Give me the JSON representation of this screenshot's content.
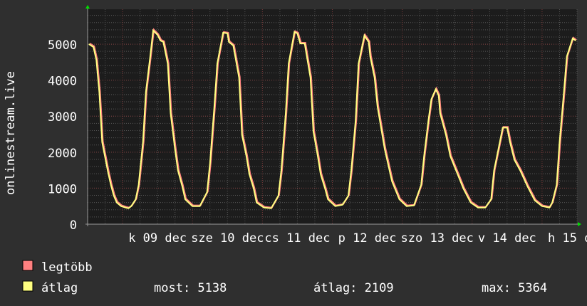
{
  "chart_data": {
    "type": "line",
    "ylabel": "onlinestream.live",
    "ylim": [
      0,
      5970
    ],
    "yticks": [
      0,
      1000,
      2000,
      3000,
      4000,
      5000
    ],
    "xrange": [
      "12-08 12:00",
      "12-15 12:00"
    ],
    "xticks": [
      {
        "t": "12-09 12:00",
        "label": "k 09 dec"
      },
      {
        "t": "12-10 12:00",
        "label": "sze 10 dec"
      },
      {
        "t": "12-11 12:00",
        "label": "cs 11 dec"
      },
      {
        "t": "12-12 12:00",
        "label": "p 12 dec"
      },
      {
        "t": "12-13 12:00",
        "label": "szo 13 dec"
      },
      {
        "t": "12-14 12:00",
        "label": "v 14 dec"
      },
      {
        "t": "12-15 12:00",
        "label": "h 15 dec"
      }
    ],
    "grid": true,
    "colors": {
      "background": "#2f2f2f",
      "canvas": "#1c1c1c",
      "grid_minor": "#555555",
      "grid_major": "#7a3a3a",
      "axis_arrow": "#00dd00"
    },
    "series": [
      {
        "name": "legtöbb",
        "color": "#ff8080"
      },
      {
        "name": "átlag",
        "color": "#ffff80"
      }
    ],
    "points": [
      [
        "12-08 12:30",
        5000
      ],
      [
        "12-08 14:00",
        4920
      ],
      [
        "12-08 15:00",
        4560
      ],
      [
        "12-08 16:00",
        3670
      ],
      [
        "12-08 17:00",
        2280
      ],
      [
        "12-08 19:00",
        1450
      ],
      [
        "12-08 20:00",
        1090
      ],
      [
        "12-08 21:00",
        790
      ],
      [
        "12-08 22:00",
        600
      ],
      [
        "12-08 23:30",
        500
      ],
      [
        "12-09 01:00",
        460
      ],
      [
        "12-09 02:00",
        440
      ],
      [
        "12-09 03:00",
        500
      ],
      [
        "12-09 04:30",
        690
      ],
      [
        "12-09 05:30",
        1090
      ],
      [
        "12-09 07:00",
        2280
      ],
      [
        "12-09 08:00",
        3670
      ],
      [
        "12-09 09:30",
        4660
      ],
      [
        "12-09 10:30",
        5380
      ],
      [
        "12-09 12:00",
        5260
      ],
      [
        "12-09 13:00",
        5100
      ],
      [
        "12-09 14:00",
        5060
      ],
      [
        "12-09 15:30",
        4460
      ],
      [
        "12-09 16:30",
        3080
      ],
      [
        "12-09 18:00",
        2080
      ],
      [
        "12-09 19:00",
        1490
      ],
      [
        "12-09 20:30",
        1050
      ],
      [
        "12-09 21:30",
        690
      ],
      [
        "12-10 00:00",
        500
      ],
      [
        "12-10 02:30",
        500
      ],
      [
        "12-10 05:00",
        890
      ],
      [
        "12-10 06:00",
        1690
      ],
      [
        "12-10 07:30",
        3270
      ],
      [
        "12-10 08:30",
        4460
      ],
      [
        "12-10 10:30",
        5320
      ],
      [
        "12-10 12:00",
        5300
      ],
      [
        "12-10 12:30",
        5060
      ],
      [
        "12-10 14:00",
        4960
      ],
      [
        "12-10 16:00",
        4070
      ],
      [
        "12-10 17:00",
        2480
      ],
      [
        "12-10 18:30",
        1890
      ],
      [
        "12-10 19:30",
        1390
      ],
      [
        "12-10 21:00",
        990
      ],
      [
        "12-10 22:00",
        600
      ],
      [
        "12-11 00:30",
        460
      ],
      [
        "12-11 03:00",
        440
      ],
      [
        "12-11 05:30",
        790
      ],
      [
        "12-11 06:30",
        1490
      ],
      [
        "12-11 08:00",
        3080
      ],
      [
        "12-11 09:00",
        4460
      ],
      [
        "12-11 11:00",
        5340
      ],
      [
        "12-11 12:00",
        5300
      ],
      [
        "12-11 13:00",
        5020
      ],
      [
        "12-11 14:30",
        5020
      ],
      [
        "12-11 16:30",
        4070
      ],
      [
        "12-11 17:30",
        2580
      ],
      [
        "12-11 19:00",
        1890
      ],
      [
        "12-11 20:00",
        1390
      ],
      [
        "12-11 21:30",
        990
      ],
      [
        "12-11 22:30",
        690
      ],
      [
        "12-12 01:00",
        500
      ],
      [
        "12-12 03:30",
        540
      ],
      [
        "12-12 05:30",
        790
      ],
      [
        "12-12 06:30",
        1490
      ],
      [
        "12-12 08:00",
        2880
      ],
      [
        "12-12 09:00",
        4460
      ],
      [
        "12-12 11:00",
        5240
      ],
      [
        "12-12 12:30",
        5060
      ],
      [
        "12-12 13:00",
        4660
      ],
      [
        "12-12 14:30",
        4070
      ],
      [
        "12-12 15:30",
        3270
      ],
      [
        "12-12 18:00",
        2080
      ],
      [
        "12-12 20:30",
        1190
      ],
      [
        "12-12 23:00",
        690
      ],
      [
        "12-13 01:30",
        500
      ],
      [
        "12-13 04:00",
        520
      ],
      [
        "12-13 06:30",
        1090
      ],
      [
        "12-13 07:30",
        1890
      ],
      [
        "12-13 09:00",
        2880
      ],
      [
        "12-13 10:00",
        3470
      ],
      [
        "12-13 11:30",
        3750
      ],
      [
        "12-13 12:30",
        3570
      ],
      [
        "12-13 13:00",
        3080
      ],
      [
        "12-13 15:00",
        2480
      ],
      [
        "12-13 16:30",
        1890
      ],
      [
        "12-13 18:30",
        1490
      ],
      [
        "12-13 21:00",
        990
      ],
      [
        "12-13 23:30",
        600
      ],
      [
        "12-14 02:00",
        460
      ],
      [
        "12-14 04:30",
        460
      ],
      [
        "12-14 06:30",
        690
      ],
      [
        "12-14 07:30",
        1490
      ],
      [
        "12-14 09:00",
        2080
      ],
      [
        "12-14 10:30",
        2680
      ],
      [
        "12-14 12:00",
        2680
      ],
      [
        "12-14 13:00",
        2280
      ],
      [
        "12-14 14:30",
        1790
      ],
      [
        "12-14 16:30",
        1490
      ],
      [
        "12-14 19:00",
        1050
      ],
      [
        "12-14 21:30",
        660
      ],
      [
        "12-15 00:00",
        500
      ],
      [
        "12-15 02:30",
        460
      ],
      [
        "12-15 03:30",
        600
      ],
      [
        "12-15 05:00",
        1090
      ],
      [
        "12-15 06:00",
        2280
      ],
      [
        "12-15 07:30",
        3670
      ],
      [
        "12-15 08:30",
        4660
      ],
      [
        "12-15 10:30",
        5160
      ],
      [
        "12-15 11:30",
        5100
      ]
    ]
  },
  "legend": {
    "max_label": "legtöbb",
    "avg_label": "átlag",
    "now": "most: 5138",
    "avg": "átlag: 2109",
    "max": "max: 5364"
  }
}
